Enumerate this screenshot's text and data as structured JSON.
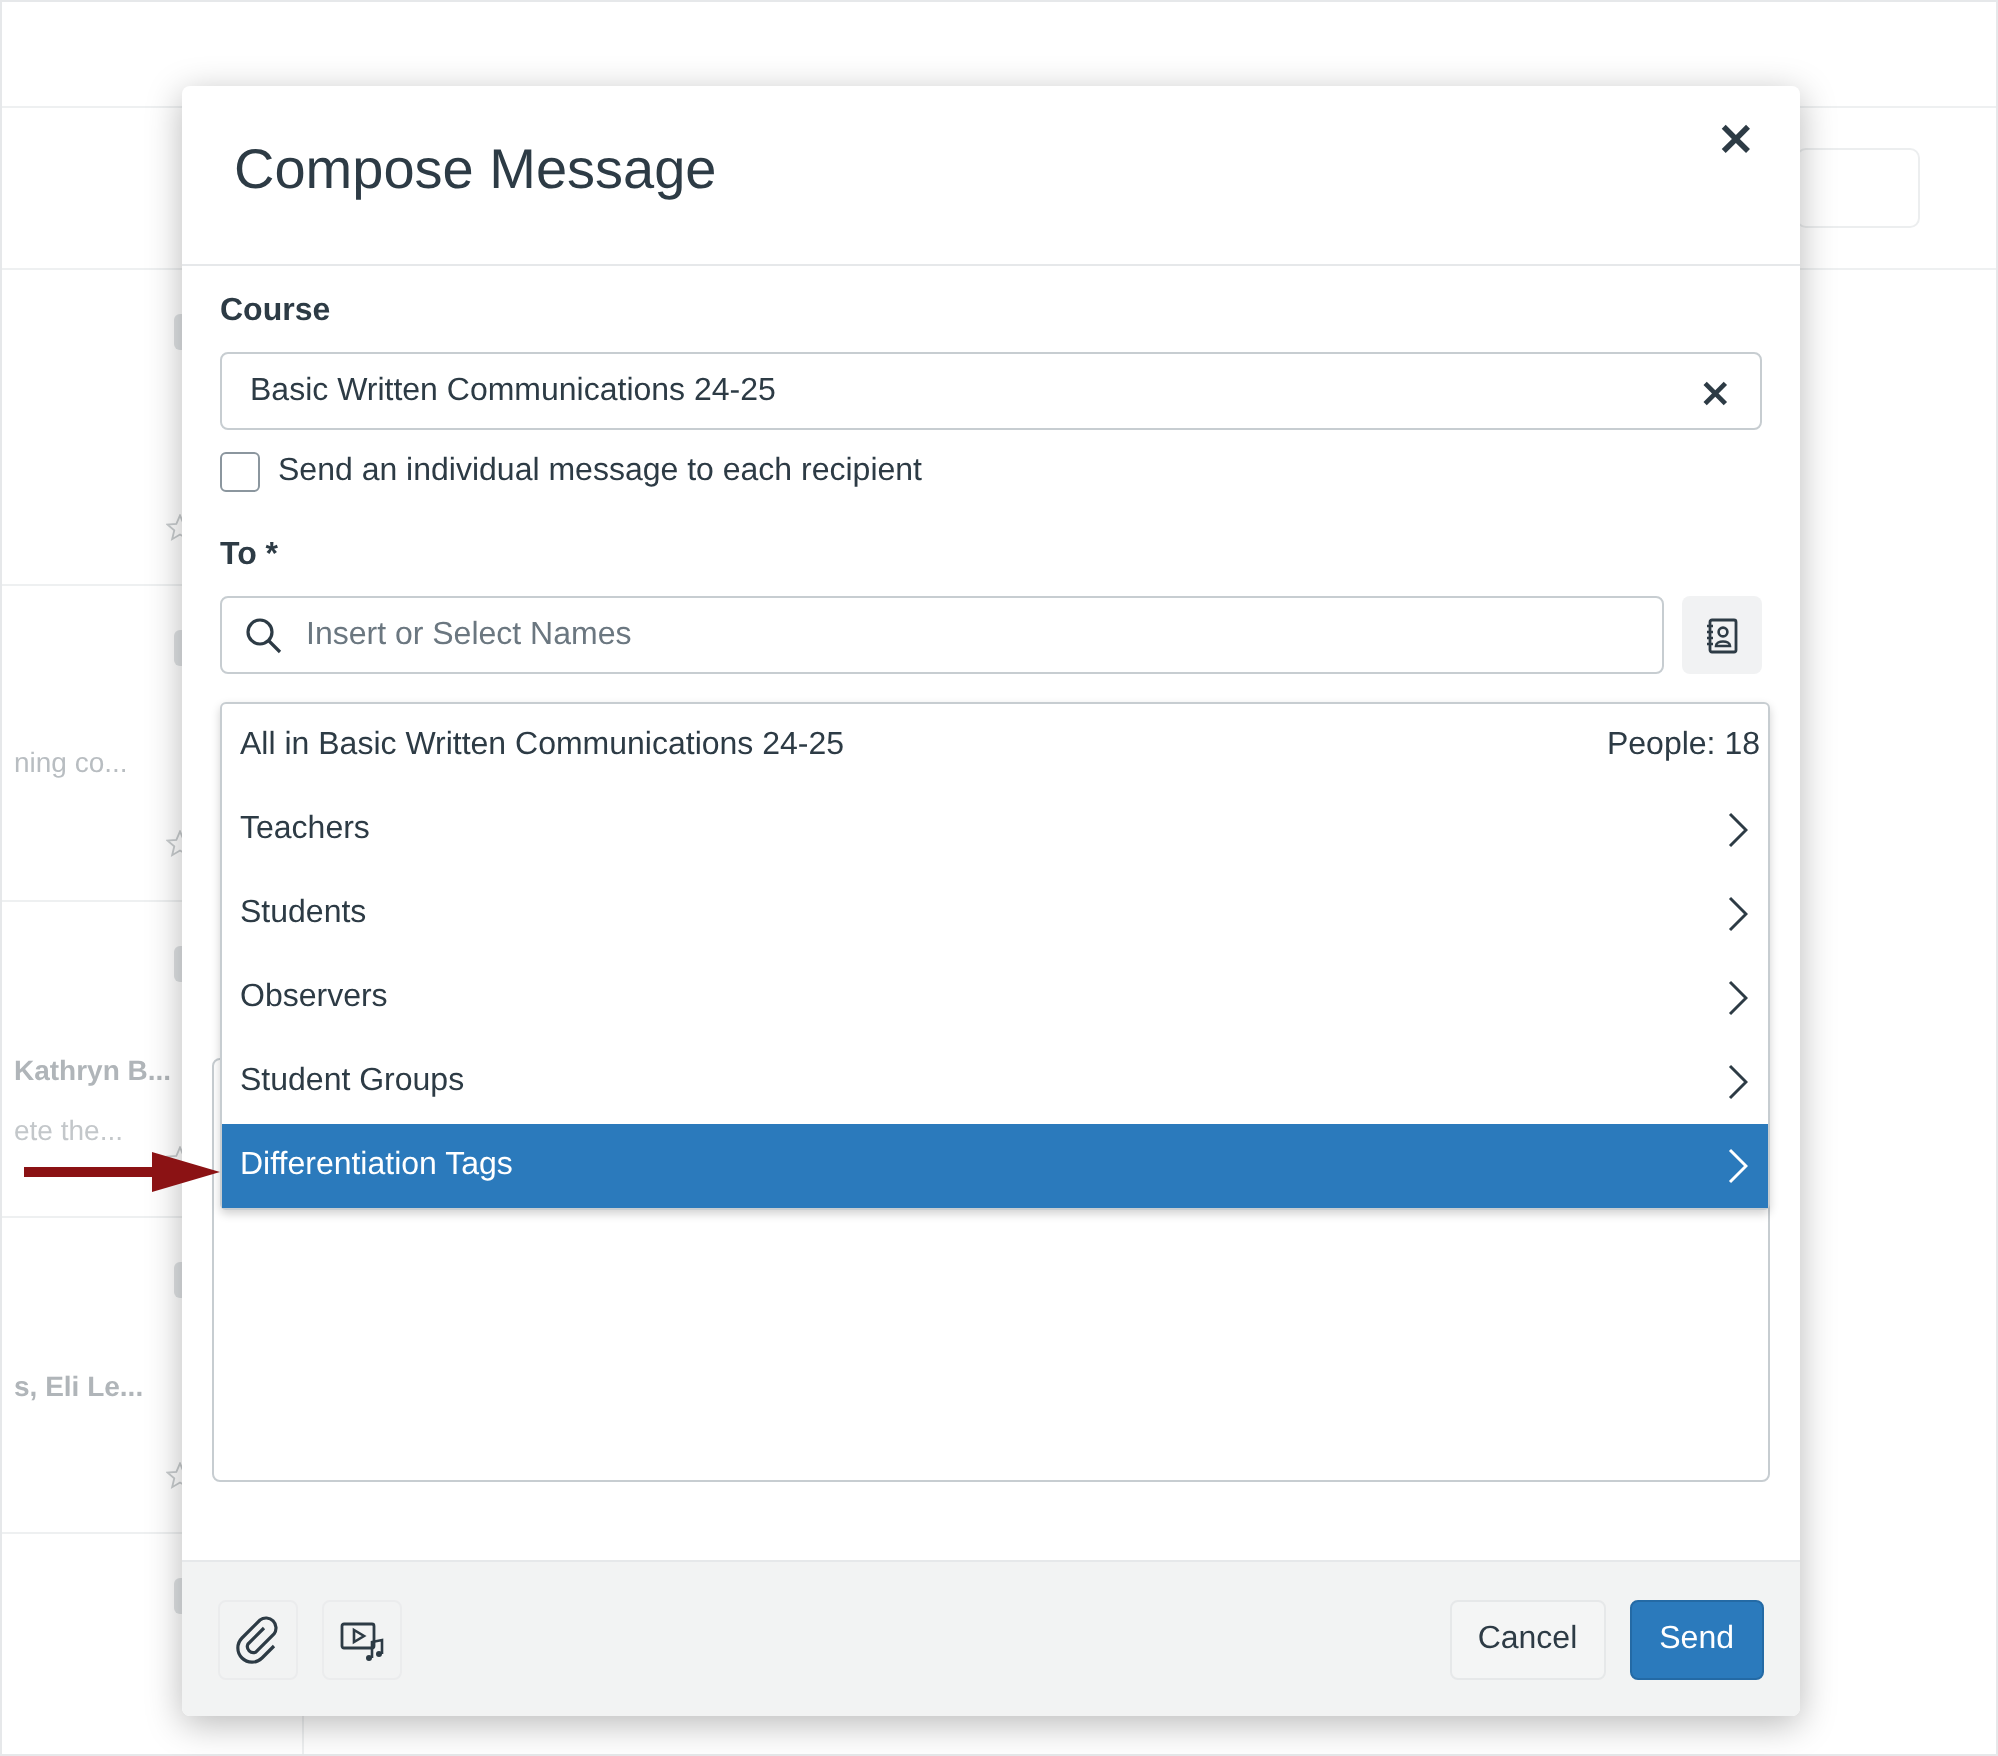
{
  "background": {
    "rows": [
      {
        "text": ""
      },
      {
        "text": "ning co..."
      },
      {
        "text": "Kathryn B...",
        "detail": "ete the..."
      },
      {
        "text": "s, Eli Le..."
      }
    ]
  },
  "dialog": {
    "title": "Compose Message",
    "close": "×",
    "course": {
      "label": "Course",
      "value": "Basic Written Communications 24-25",
      "clear": "×"
    },
    "individual": {
      "label": "Send an individual message to each recipient",
      "checked": false
    },
    "to": {
      "label": "To *",
      "placeholder": "Insert or Select Names"
    },
    "menu": [
      {
        "label": "All in Basic Written Communications 24-25",
        "count": "People: 18",
        "selected": false
      },
      {
        "label": "Teachers",
        "selected": false
      },
      {
        "label": "Students",
        "selected": false
      },
      {
        "label": "Observers",
        "selected": false
      },
      {
        "label": "Student Groups",
        "selected": false
      },
      {
        "label": "Differentiation Tags",
        "selected": true
      }
    ],
    "buttons": [
      {
        "label": "Cancel",
        "kind": "secondary"
      },
      {
        "label": "Send",
        "kind": "primary"
      }
    ]
  }
}
